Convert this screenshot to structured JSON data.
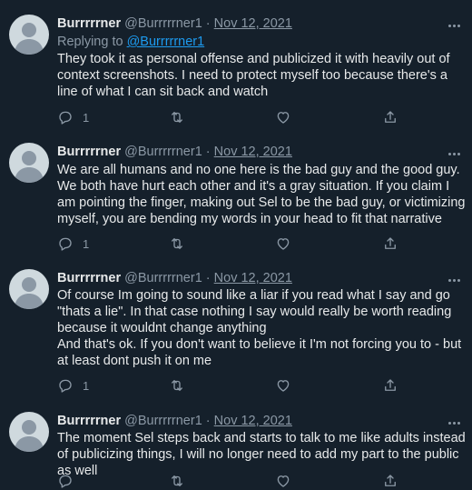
{
  "tweets": [
    {
      "name": "Burrrrrner",
      "handle": "@Burrrrrner1",
      "separator": "·",
      "date": "Nov 12, 2021",
      "replying_prefix": "Replying to",
      "replying_handle": "@Burrrrrner1",
      "text": "They took it as personal offense and publicized it with heavily out of context screenshots. I need to protect myself too because there's a line of what I can sit back and watch",
      "reply_count": "1"
    },
    {
      "name": "Burrrrrner",
      "handle": "@Burrrrrner1",
      "separator": "·",
      "date": "Nov 12, 2021",
      "text": "We are all humans and no one here is the bad guy and the good guy. We both have hurt each other and it's a gray situation. If you claim I am pointing the finger, making out Sel to be the bad guy, or victimizing myself, you are bending my words in your head to fit that narrative",
      "reply_count": "1"
    },
    {
      "name": "Burrrrrner",
      "handle": "@Burrrrrner1",
      "separator": "·",
      "date": "Nov 12, 2021",
      "text": "Of course Im going to sound like a liar if you read what I say and go \"thats a lie\". In that case nothing I say would really be worth reading because it wouldnt change anything\nAnd that's ok. If you don't want to believe it I'm not forcing you to - but at least dont push it on me",
      "reply_count": "1"
    },
    {
      "name": "Burrrrrner",
      "handle": "@Burrrrrner1",
      "separator": "·",
      "date": "Nov 12, 2021",
      "text": "The moment Sel steps back and starts to talk to me like adults instead of publicizing things, I will no longer need to add my part to the public as well",
      "reply_count": ""
    }
  ],
  "icons": {
    "reply": "reply-icon",
    "retweet": "retweet-icon",
    "like": "like-icon",
    "share": "share-icon",
    "more": "more-icon",
    "avatar": "default-avatar"
  },
  "colors": {
    "background": "#15202b",
    "text": "#e7e9ea",
    "secondary": "#8b98a5",
    "link": "#1d9bf0",
    "avatar": "#cfd9de"
  }
}
